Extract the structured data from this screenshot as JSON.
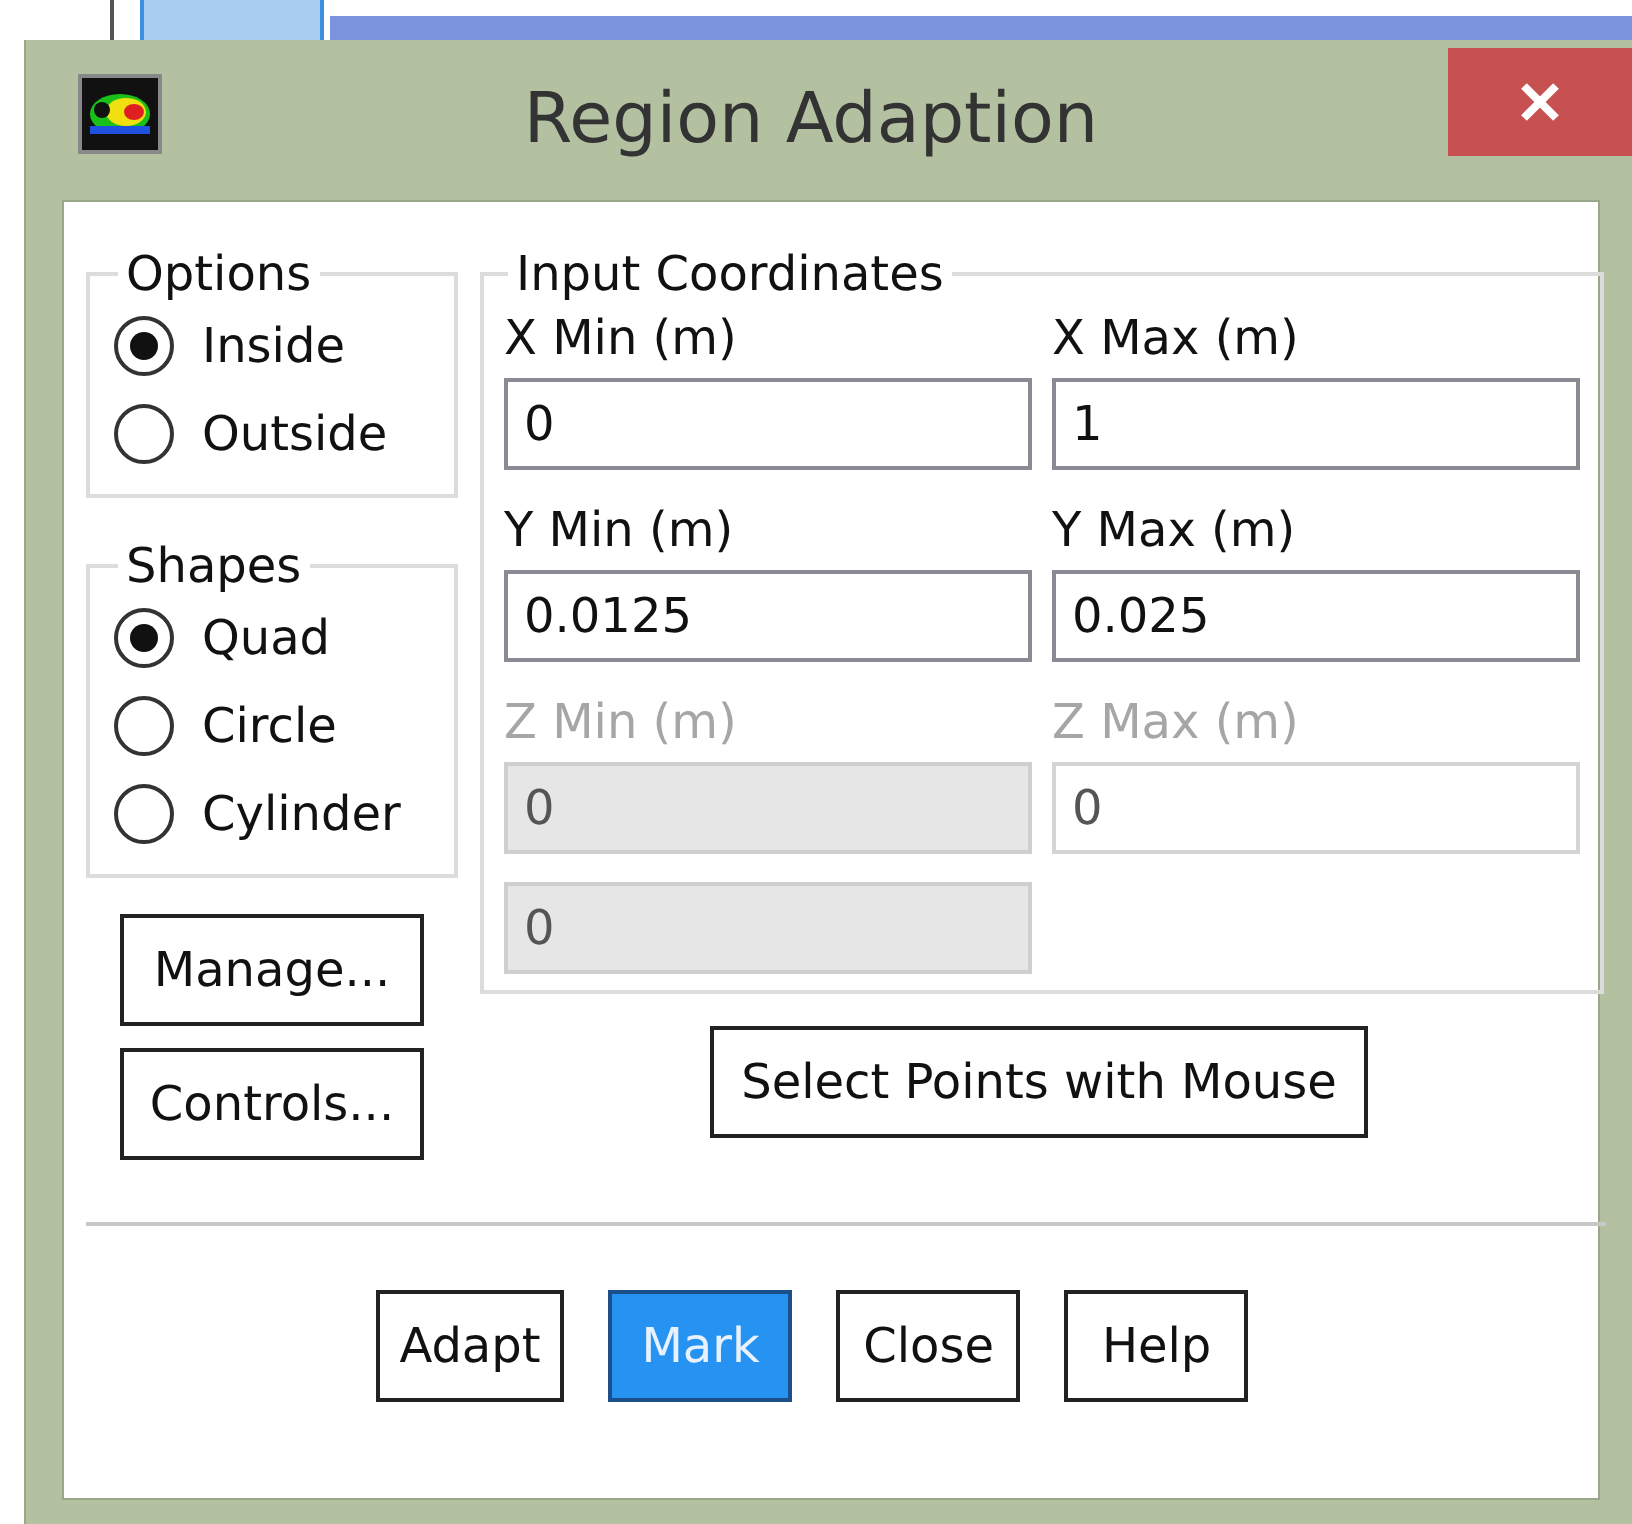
{
  "window": {
    "title": "Region Adaption"
  },
  "options": {
    "label": "Options",
    "items": [
      {
        "label": "Inside",
        "selected": true
      },
      {
        "label": "Outside",
        "selected": false
      }
    ]
  },
  "shapes": {
    "label": "Shapes",
    "items": [
      {
        "label": "Quad",
        "selected": true
      },
      {
        "label": "Circle",
        "selected": false
      },
      {
        "label": "Cylinder",
        "selected": false
      }
    ]
  },
  "side_buttons": [
    "Manage...",
    "Controls..."
  ],
  "input_coordinates": {
    "label": "Input Coordinates",
    "fields": [
      {
        "label": "X Min (m)",
        "value": "0",
        "disabled": false,
        "shaded": false
      },
      {
        "label": "X Max (m)",
        "value": "1",
        "disabled": false,
        "shaded": false
      },
      {
        "label": "Y Min (m)",
        "value": "0.0125",
        "disabled": false,
        "shaded": false
      },
      {
        "label": "Y Max (m)",
        "value": "0.025",
        "disabled": false,
        "shaded": false
      },
      {
        "label": "Z Min (m)",
        "value": "0",
        "disabled": true,
        "shaded": true
      },
      {
        "label": "Z Max (m)",
        "value": "0",
        "disabled": true,
        "shaded": false
      },
      {
        "value": "0",
        "disabled": true,
        "shaded": true
      }
    ]
  },
  "select_button": "Select Points with Mouse",
  "buttons": [
    {
      "label": "Adapt",
      "selected": false
    },
    {
      "label": "Mark",
      "selected": true
    },
    {
      "label": "Close",
      "selected": false
    },
    {
      "label": "Help",
      "selected": false
    }
  ]
}
